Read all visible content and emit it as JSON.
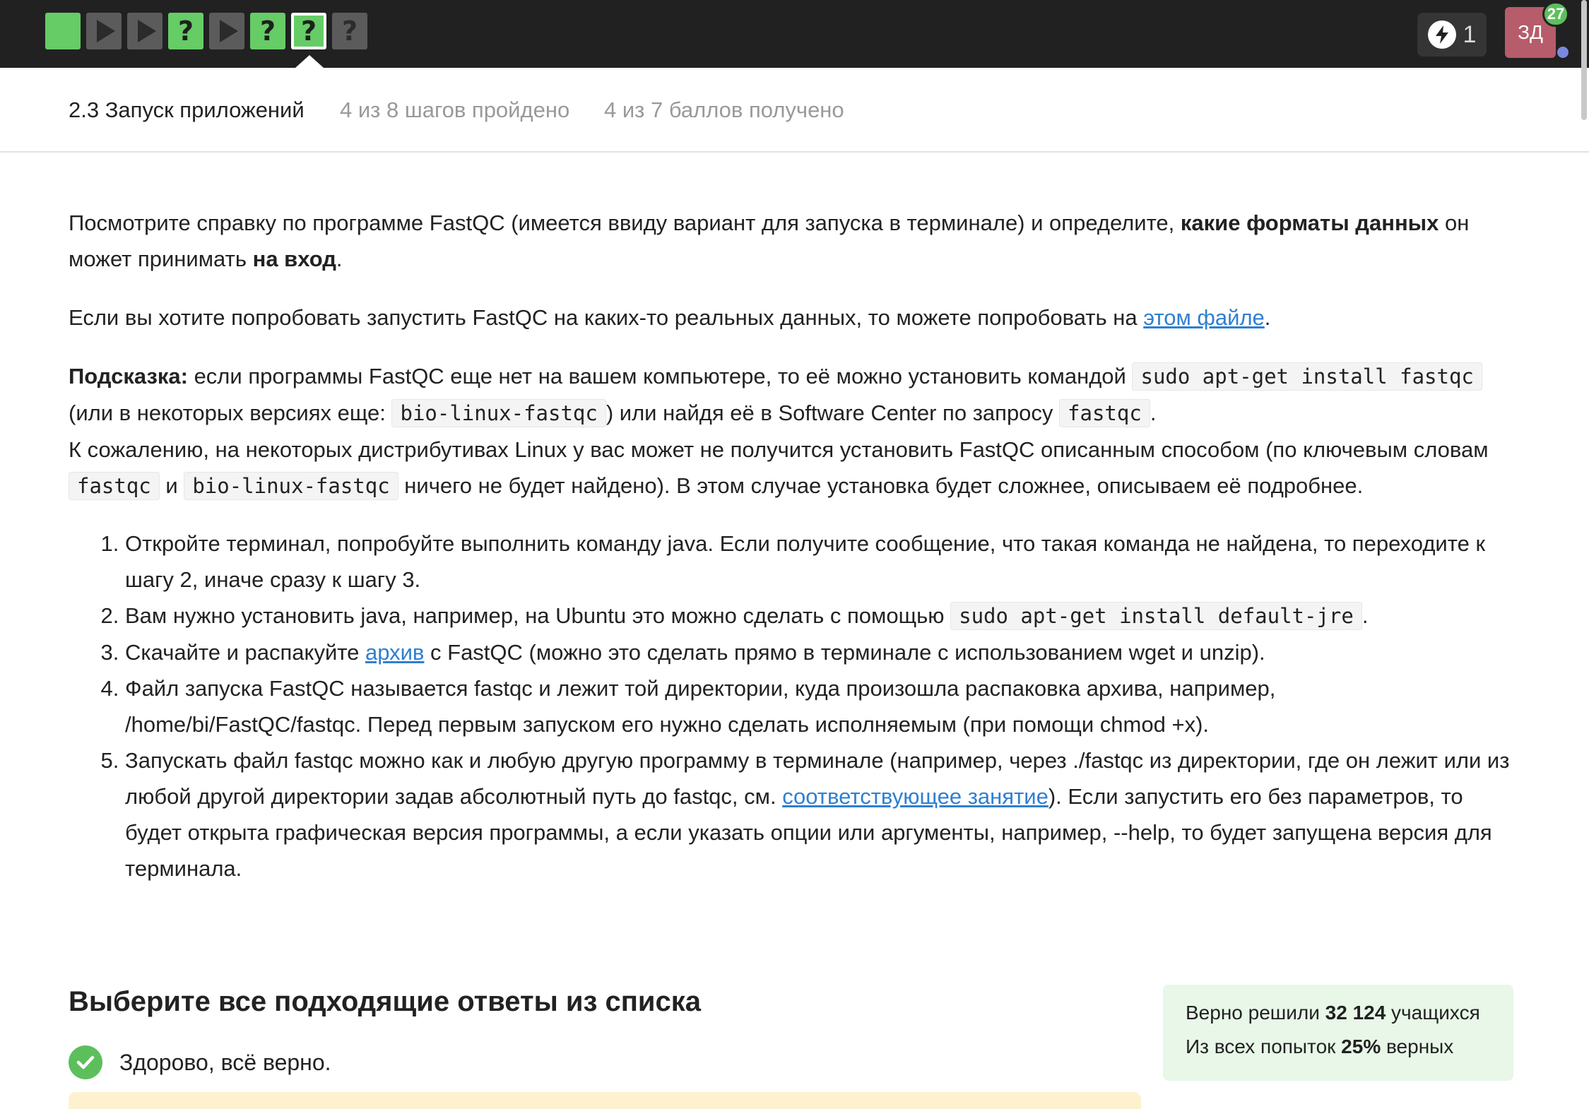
{
  "topbar": {
    "steps": [
      {
        "kind": "done",
        "type": "text",
        "symbol": ""
      },
      {
        "kind": "todo",
        "type": "video",
        "symbol": ""
      },
      {
        "kind": "todo",
        "type": "video",
        "symbol": ""
      },
      {
        "kind": "done",
        "type": "quiz",
        "symbol": "?"
      },
      {
        "kind": "todo",
        "type": "video",
        "symbol": ""
      },
      {
        "kind": "done",
        "type": "quiz",
        "symbol": "?"
      },
      {
        "kind": "done-current",
        "type": "quiz",
        "symbol": "?"
      },
      {
        "kind": "todo",
        "type": "quiz",
        "symbol": "?"
      }
    ],
    "energy_count": "1",
    "avatar_initials": "ЗД",
    "notification_count": "27"
  },
  "lesson": {
    "title": "2.3 Запуск приложений",
    "steps_progress": "4 из 8 шагов пройдено",
    "points_progress": "4 из 7 баллов  получено"
  },
  "content": {
    "task": {
      "text1": "Посмотрите справку по программе FastQC (имеется ввиду вариант для запуска в терминале) и определите, ",
      "bold1": "какие форматы данных",
      "text2": " он может принимать ",
      "bold2": "на вход",
      "text3": "."
    },
    "try": {
      "text1": "Если вы хотите попробовать запустить FastQC на каких-то реальных данных, то можете попробовать на ",
      "link": "этом файле",
      "text2": "."
    },
    "hint": {
      "label": "Подсказка:",
      "t1": " если программы FastQC еще нет на вашем компьютере, то её можно установить командой ",
      "code1": "sudo apt-get install fastqc",
      "t2": " (или в некоторых версиях еще: ",
      "code2": "bio-linux-fastqc",
      "t3": ") или найдя её в Software Center по запросу ",
      "code3": "fastqc",
      "t4": ".",
      "t5": "К сожалению, на некоторых дистрибутивах Linux у вас может не получится установить FastQC описанным способом (по ключевым словам ",
      "code4": "fastqc",
      "t6": " и ",
      "code5": "bio-linux-fastqc",
      "t7": " ничего не будет найдено). В этом случае установка будет сложнее, описываем её подробнее."
    },
    "steps": {
      "s1": "Откройте терминал, попробуйте выполнить команду java. Если получите сообщение, что такая команда не найдена, то переходите к шагу 2, иначе сразу к шагу 3.",
      "s2_text": "Вам нужно установить java, например, на Ubuntu это можно сделать с помощью ",
      "s2_code": "sudo apt-get install default-jre",
      "s2_end": ".",
      "s3_text1": "Скачайте и распакуйте ",
      "s3_link": "архив",
      "s3_text2": " с FastQC (можно это сделать прямо в терминале с использованием wget и unzip).",
      "s4": "Файл запуска FastQC называется fastqc и лежит той директории, куда произошла распаковка архива, например, /home/bi/FastQC/fastqc. Перед первым запуском его нужно сделать исполняемым (при помощи chmod +x).",
      "s5_text1": "Запускать файл fastqc можно как и любую другую программу в терминале (например, через ./fastqc из директории, где он лежит или из любой другой директории задав абсолютный путь до fastqc, см. ",
      "s5_link": "соответствующее занятие",
      "s5_text2": "). Если запустить его без параметров, то будет открыта графическая версия программы, а если указать опции или аргументы, например, --help, то будет запущена версия для терминала."
    }
  },
  "quiz": {
    "title": "Выберите все подходящие ответы из списка",
    "result": "Здорово, всё верно."
  },
  "stats": {
    "line1_pre": "Верно решили ",
    "line1_num": "32 124",
    "line1_post": " учащихся",
    "line2_pre": "Из всех попыток ",
    "line2_num": "25%",
    "line2_post": " верных"
  },
  "colors": {
    "topbar": "#212121",
    "done_step": "#66cc66",
    "todo_step": "#5b5b5b",
    "link": "#2f7fd1",
    "stats_bg": "#e8f7e8",
    "success": "#5cbf5c"
  }
}
